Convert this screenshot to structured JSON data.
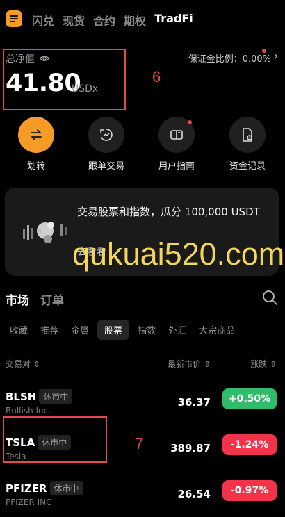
{
  "nav": {
    "tabs": [
      "闪兑",
      "现货",
      "合约",
      "期权",
      "TradFi"
    ],
    "active_index": 4
  },
  "account": {
    "net_value_label": "总净值",
    "net_value": "41.80",
    "unit": "USDx",
    "margin_ratio": "保证金比例：0.00%"
  },
  "annotations": {
    "box1": "6",
    "box2": "7"
  },
  "actions": [
    {
      "label": "划转",
      "icon": "transfer-icon"
    },
    {
      "label": "跟单交易",
      "icon": "copy-trade-icon"
    },
    {
      "label": "用户指南",
      "icon": "guide-icon"
    },
    {
      "label": "资金记录",
      "icon": "record-icon"
    }
  ],
  "promo": {
    "text": "交易股票和指数，瓜分 100,000 USDT",
    "link": "去看看",
    "watermark": "qukuai520.com"
  },
  "market": {
    "tabs": [
      "市场",
      "订单"
    ],
    "categories": [
      "收藏",
      "推荐",
      "金属",
      "股票",
      "指数",
      "外汇",
      "大宗商品"
    ],
    "active_category": "股票",
    "headers": {
      "pair": "交易对 ⇕",
      "price": "最新市价 ⇕",
      "change": "涨跌 ⇕"
    },
    "rows": [
      {
        "symbol": "BLSH",
        "badge": "休市中",
        "name": "Bullish Inc.",
        "price": "36.37",
        "change": "+0.50%",
        "dir": "up"
      },
      {
        "symbol": "TSLA",
        "badge": "休市中",
        "name": "Tesla",
        "price": "389.87",
        "change": "-1.24%",
        "dir": "down"
      },
      {
        "symbol": "PFIZER",
        "badge": "休市中",
        "name": "PFIZER INC",
        "price": "26.54",
        "change": "-0.97%",
        "dir": "down"
      }
    ]
  },
  "colors": {
    "accent": "#f59b26",
    "up": "#2fbd6c",
    "down": "#f2334a",
    "annotation": "#e5484d"
  }
}
